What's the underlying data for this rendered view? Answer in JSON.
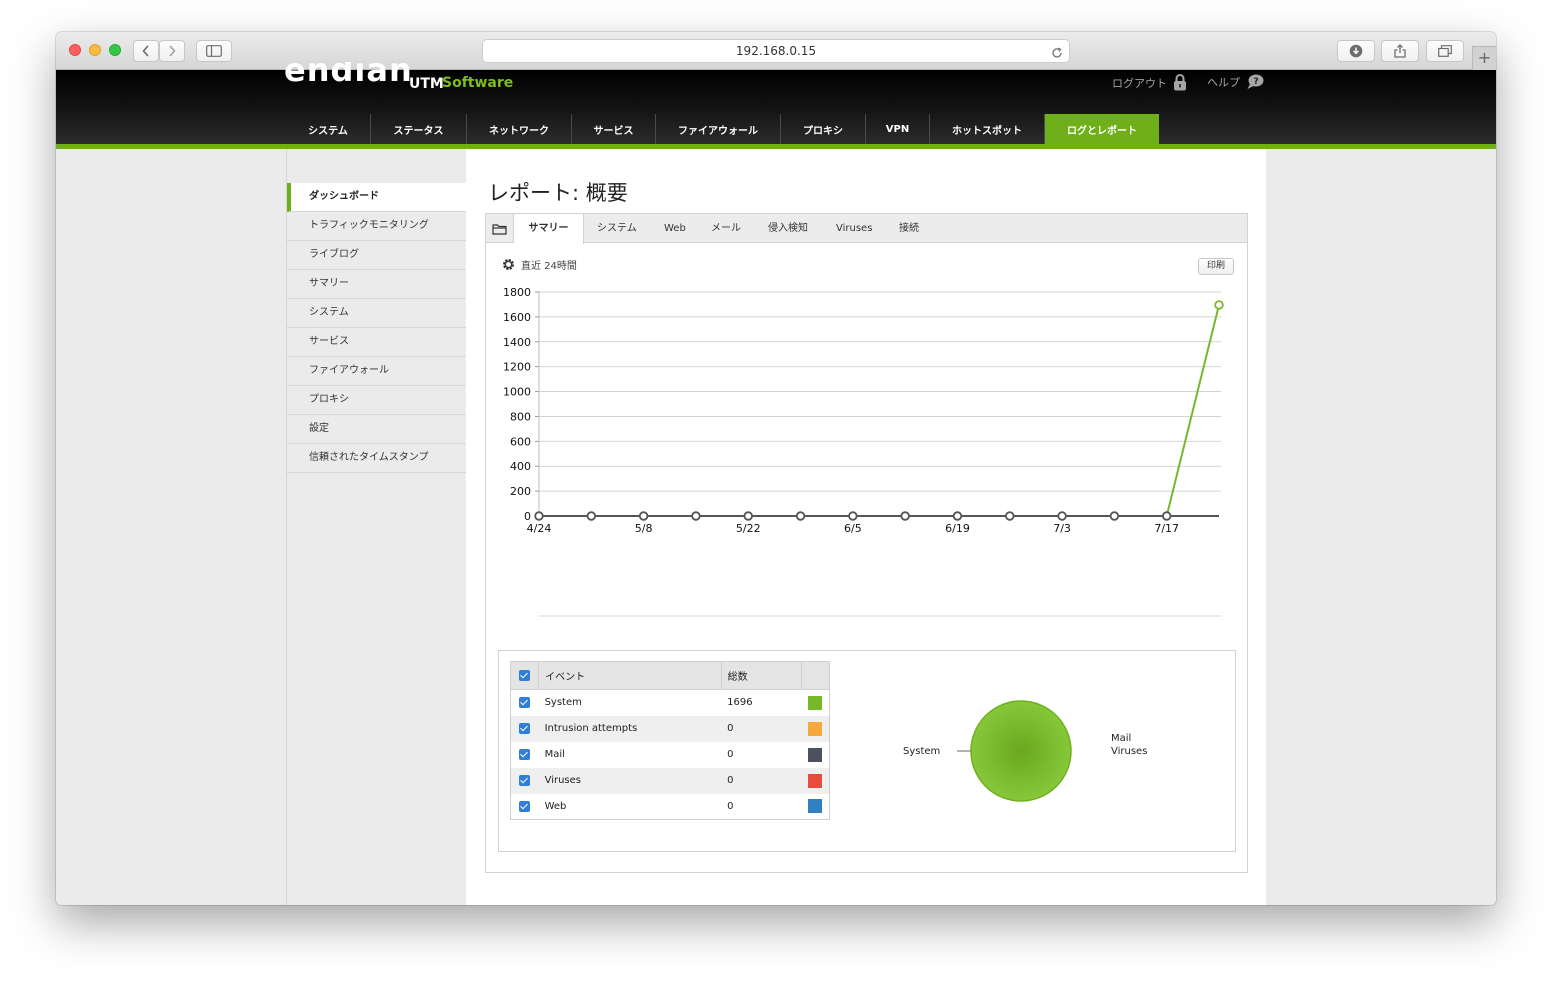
{
  "browser": {
    "url": "192.168.0.15"
  },
  "header": {
    "logo_text": "endian",
    "logo_utm": "UTM",
    "logo_software": "Software",
    "logout_label": "ログアウト",
    "help_label": "ヘルプ"
  },
  "nav": {
    "items": [
      {
        "label": "システム"
      },
      {
        "label": "ステータス"
      },
      {
        "label": "ネットワーク"
      },
      {
        "label": "サービス"
      },
      {
        "label": "ファイアウォール"
      },
      {
        "label": "プロキシ"
      },
      {
        "label": "VPN"
      },
      {
        "label": "ホットスポット"
      },
      {
        "label": "ログとレポート",
        "active": true
      }
    ]
  },
  "sidebar": {
    "items": [
      {
        "label": "ダッシュボード",
        "active": true
      },
      {
        "label": "トラフィックモニタリング"
      },
      {
        "label": "ライブログ"
      },
      {
        "label": "サマリー"
      },
      {
        "label": "システム"
      },
      {
        "label": "サービス"
      },
      {
        "label": "ファイアウォール"
      },
      {
        "label": "プロキシ"
      },
      {
        "label": "設定"
      },
      {
        "label": "信頼されたタイムスタンプ"
      }
    ]
  },
  "page": {
    "title": "レポート: 概要",
    "tabs": [
      {
        "label": "サマリー",
        "active": true
      },
      {
        "label": "システム"
      },
      {
        "label": "Web"
      },
      {
        "label": "メール"
      },
      {
        "label": "侵入検知"
      },
      {
        "label": "Viruses"
      },
      {
        "label": "接続"
      }
    ],
    "period_label": "直近 24時間",
    "print_label": "印刷"
  },
  "chart_data": [
    {
      "type": "line",
      "title": "",
      "xlabel": "",
      "ylabel": "",
      "ylim": [
        0,
        1800
      ],
      "yticks": [
        0,
        200,
        400,
        600,
        800,
        1000,
        1200,
        1400,
        1600,
        1800
      ],
      "x": [
        "4/24",
        "5/1",
        "5/8",
        "5/15",
        "5/22",
        "5/29",
        "6/5",
        "6/12",
        "6/19",
        "6/26",
        "7/3",
        "7/10",
        "7/17",
        "7/24"
      ],
      "xtick_labels": [
        "4/24",
        "",
        "5/8",
        "",
        "5/22",
        "",
        "6/5",
        "",
        "6/19",
        "",
        "7/3",
        "",
        "7/17",
        ""
      ],
      "series": [
        {
          "values": [
            0,
            0,
            0,
            0,
            0,
            0,
            0,
            0,
            0,
            0,
            0,
            0,
            0,
            1696
          ],
          "color": "#76b82a"
        }
      ],
      "grid": true,
      "legend": "none"
    },
    {
      "type": "pie",
      "labels": [
        "System",
        "Mail",
        "Viruses"
      ],
      "values": [
        1696,
        0,
        0
      ],
      "colors": [
        "#76b82a",
        "#4a5260",
        "#e84c3d"
      ]
    }
  ],
  "events_table": {
    "col_event": "イベント",
    "col_total": "総数",
    "rows": [
      {
        "name": "System",
        "total": "1696",
        "color": "#76b82a"
      },
      {
        "name": "Intrusion attempts",
        "total": "0",
        "color": "#f5a93a"
      },
      {
        "name": "Mail",
        "total": "0",
        "color": "#4a5260"
      },
      {
        "name": "Viruses",
        "total": "0",
        "color": "#e84c3d"
      },
      {
        "name": "Web",
        "total": "0",
        "color": "#2f7fc1"
      }
    ]
  },
  "icons": {
    "back": "chevron-left-icon",
    "forward": "chevron-right-icon",
    "sidebar_toggle": "sidebar-icon",
    "reload": "reload-icon",
    "download": "download-icon",
    "share": "share-icon",
    "tabs": "tabs-icon",
    "lock": "lock-icon",
    "help": "help-bubble-icon",
    "folder": "folder-icon",
    "gear": "gear-icon"
  }
}
